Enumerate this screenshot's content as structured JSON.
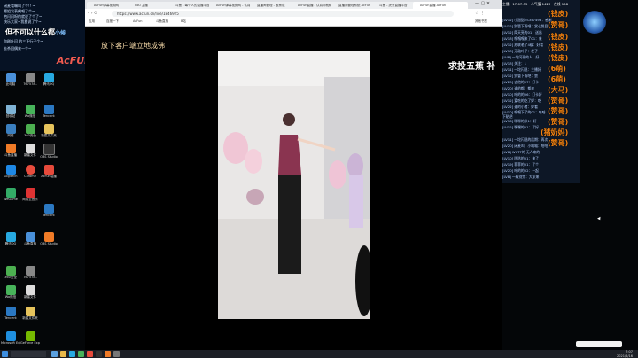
{
  "overlay": {
    "lines": [
      "闭麦看嘛叫了个!! ~",
      "嗯姐发表偶吧了个~",
      "抱闪闪呀的就说了个了~",
      "快乐大家~我靠说了个~",
      "你刷吐闪 的三下行子个~",
      "去杀回偶来一个~"
    ],
    "big_text": "但不可以什么都",
    "big_text_blue": "小候",
    "brand": "AcFUN"
  },
  "browser": {
    "tabs": [
      {
        "label": "AcFun弹幕视频网"
      },
      {
        "label": "dou 主播"
      },
      {
        "label": "斗鱼 - 每个人的直播平台"
      },
      {
        "label": "AcFun弹幕视频网 - 认真你就输啦"
      },
      {
        "label": "直播间管理 - 股票说"
      },
      {
        "label": "AcFun直播 - 认真你就输啦"
      },
      {
        "label": "直播间管理系统 AcFun"
      },
      {
        "label": "斗鱼 - 虎牙直播平台"
      },
      {
        "label": "AcFun直播 AcFun"
      }
    ],
    "url": "https://www.acfun.cn/live/1846925",
    "bookmarks": [
      "应用",
      "百度一下",
      "AcFun",
      "斗鱼直播",
      "B站",
      "其他书签"
    ],
    "title_left": "放下客户端立地成佛",
    "title_right": "求投五蕉 补"
  },
  "desktop_icons": [
    {
      "label": "此电脑",
      "color": "#4a90d9"
    },
    {
      "label": "767578..",
      "color": "#888"
    },
    {
      "label": "腾讯QQ",
      "color": "#27a9e1"
    },
    {
      "label": "回收站",
      "color": "#7fb3d5"
    },
    {
      "label": "Wo微信",
      "color": "#47b35a"
    },
    {
      "label": "网络",
      "color": "#3b7fbf"
    },
    {
      "label": "360安全",
      "color": "#4caf50"
    },
    {
      "label": "新建文件夹",
      "color": "#e6c35c"
    },
    {
      "label": "斗鱼直播",
      "color": "#f07b27"
    },
    {
      "label": "Tencent",
      "color": "#2b78c2"
    },
    {
      "label": "新建文件",
      "color": "#ddd"
    },
    {
      "label": "OBS Studio",
      "color": "#333"
    },
    {
      "label": "Logitech",
      "color": "#1e88e5"
    },
    {
      "label": "Chrome",
      "color": "#e84c3d"
    },
    {
      "label": "AcFun直播",
      "color": "#e64a3b"
    },
    {
      "label": "网易云音乐",
      "color": "#d33"
    },
    {
      "label": "WeGame",
      "color": "#3a6"
    },
    {
      "label": "Microsoft Edge",
      "color": "#1f8fe0"
    },
    {
      "label": "GeForce Experience",
      "color": "#76b900"
    }
  ],
  "chat": {
    "lines": [
      "主播：17:07:55 · 人气值 1423 · 在线 108",
      "[LV12] 小甜甜ZS357498：感谢",
      "[LV12] 别管下雨吧：赏心悦目",
      "[LV12] 简天亮的01：送出",
      "[LV13] 嘎嘎嘎来了01：来",
      "[LV12] 苏联老了4级：好看",
      "[LV13] 无敌叶子：发了",
      "[LV8] 一坨闪现的人：好",
      "[LV13] 关注：1",
      "[LV11] 一坨闪现：主播好",
      "[LV12] 别管下雨吧：赞",
      "[LV20] 吉他的07：打卡",
      "[LV20] 谁的都：都来",
      "[LV10] 叶的的06：打卡好",
      "[LV12] 爱吃的吃了好：吃",
      "[LV22] 谁的小猪：好看",
      "[LV10] 嘎嘎下了的01：哈哈",
      "下贴吧",
      "[LV16] 咪咪的米1：好",
      "[LV12] 嘿嘿的01：了好",
      "[LV11] 一坨闪现的后期：再次",
      "[LV20] 闭麦叫：小喵喵：哈哈",
      "[LV8] WUTF的 无人来的",
      "[LV10] 咕咕的01：来了",
      "[LV19] 菲菲的01：了个",
      "[LV20] 叶的的02：一起",
      "[LV8] 一级别完：大家来"
    ],
    "gifts": [
      "(钱皮)",
      "(赞哥)",
      "(钱皮)",
      "(钱皮)",
      "(钱皮)",
      "(钱皮)",
      "(6萌)",
      "(6萌)",
      "(大马)",
      "(赞哥)",
      "(赞哥)",
      "(赞哥)",
      "(猪奶妈)",
      "(赞哥)"
    ]
  },
  "taskbar": {
    "time": "7:07",
    "date": "2021/6/16"
  }
}
